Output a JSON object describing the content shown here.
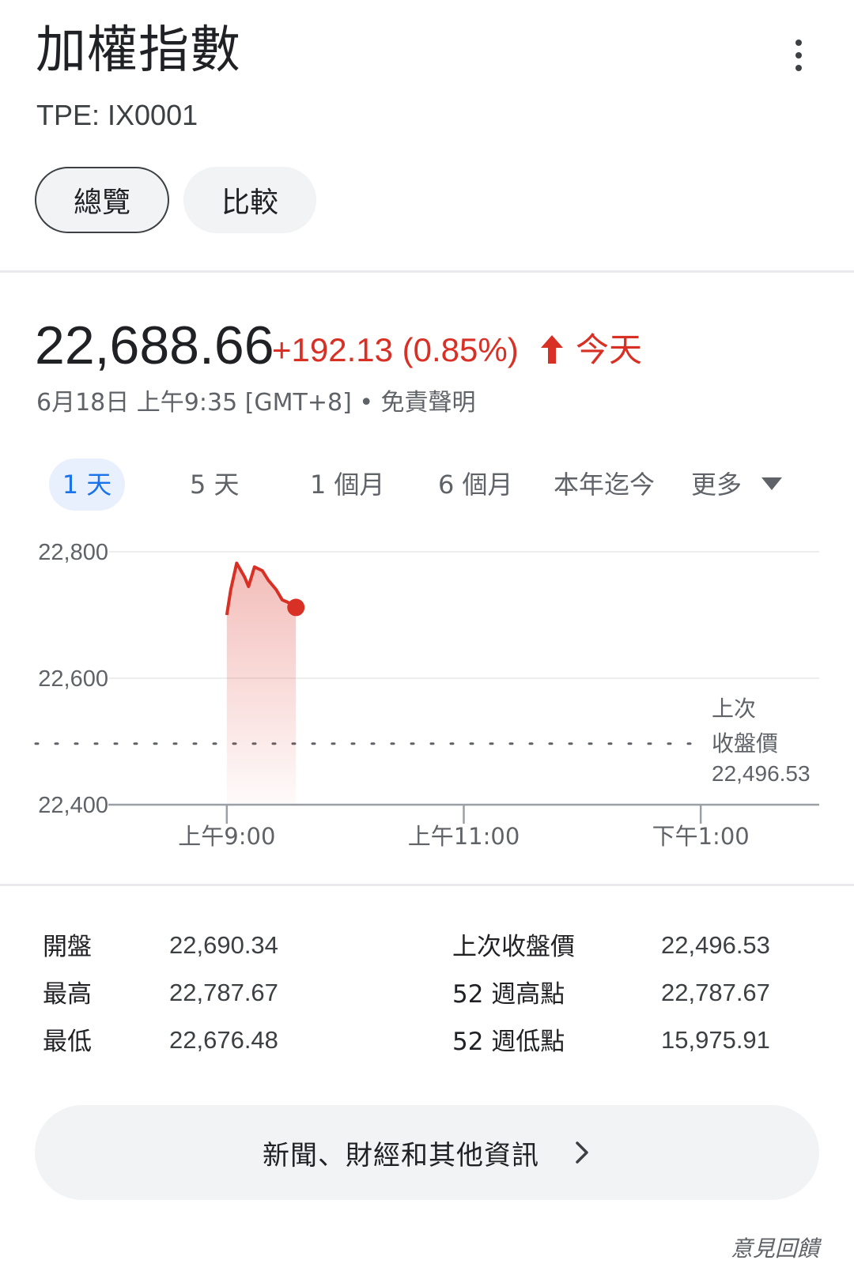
{
  "header": {
    "title": "加權指數",
    "ticker": "TPE: IX0001",
    "menu_icon": "more-vert-icon"
  },
  "tabs": [
    {
      "label": "總覽",
      "selected": true
    },
    {
      "label": "比較",
      "selected": false
    }
  ],
  "quote": {
    "price": "22,688.66",
    "change": "+192.13 (0.85%)",
    "direction_icon": "arrow-up-icon",
    "period": "今天",
    "timestamp": "6月18日 上午9:35 [GMT+8] • 免責聲明",
    "up_color": "#d93025"
  },
  "ranges": [
    {
      "label": "1 天",
      "selected": true
    },
    {
      "label": "5 天",
      "selected": false
    },
    {
      "label": "1 個月",
      "selected": false
    },
    {
      "label": "6 個月",
      "selected": false
    },
    {
      "label": "本年迄今",
      "selected": false
    },
    {
      "label": "更多",
      "selected": false
    }
  ],
  "chart_data": {
    "type": "line",
    "xlabel": "",
    "ylabel": "",
    "ylim": [
      22400,
      22800
    ],
    "yticks": [
      "22,800",
      "22,600",
      "22,400"
    ],
    "ytick_values": [
      22800,
      22600,
      22400
    ],
    "xticks": [
      "上午9:00",
      "上午11:00",
      "下午1:00"
    ],
    "xtick_hours": [
      9,
      11,
      13
    ],
    "xlim_hours": [
      8.0,
      14.0
    ],
    "series": [
      {
        "x": [
          "09:00",
          "09:02",
          "09:05",
          "09:09",
          "09:11",
          "09:14",
          "09:18",
          "09:21",
          "09:25",
          "09:28",
          "09:31",
          "09:35"
        ],
        "values": [
          22700,
          22740,
          22782,
          22760,
          22745,
          22776,
          22770,
          22755,
          22740,
          22724,
          22720,
          22712
        ]
      }
    ],
    "reference_line": {
      "label_line1": "上次",
      "label_line2": "收盤價",
      "value_label": "22,496.53",
      "value": 22496.53
    },
    "line_color": "#d93025",
    "grid": true
  },
  "stats": {
    "left": [
      {
        "label": "開盤",
        "value": "22,690.34"
      },
      {
        "label": "最高",
        "value": "22,787.67"
      },
      {
        "label": "最低",
        "value": "22,676.48"
      }
    ],
    "right": [
      {
        "label": "上次收盤價",
        "value": "22,496.53"
      },
      {
        "label": "52 週高點",
        "value": "22,787.67"
      },
      {
        "label": "52 週低點",
        "value": "15,975.91"
      }
    ]
  },
  "news_button": {
    "label": "新聞、財經和其他資訊",
    "icon": "chevron-right-icon"
  },
  "feedback": "意見回饋"
}
